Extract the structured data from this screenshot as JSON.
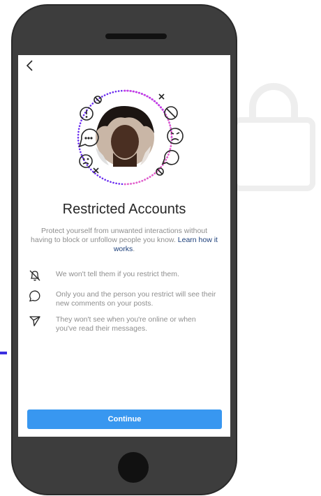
{
  "header": {
    "back_icon": "chevron-left-icon"
  },
  "hero": {
    "icons": [
      "warning-bubble-icon",
      "ellipsis-bubble-icon",
      "sad-face-icon",
      "angry-face-icon",
      "blocked-icon",
      "close-x-icon",
      "empty-bubble-icon"
    ],
    "ring_colors": [
      "#7b2cf5",
      "#c93cf0",
      "#f36fc0"
    ]
  },
  "content": {
    "title": "Restricted Accounts",
    "subtitle": "Protect yourself from unwanted interactions without having to block or unfollow people you know.",
    "learn_link": "Learn how it works",
    "period": "."
  },
  "features": [
    {
      "icon": "bell-off-icon",
      "text": "We won't tell them if you restrict them."
    },
    {
      "icon": "comment-bubble-icon",
      "text": "Only you and the person you restrict will see their new comments on your posts."
    },
    {
      "icon": "paper-plane-icon",
      "text": "They won't see when you're online or when you've read their messages."
    }
  ],
  "actions": {
    "continue_label": "Continue"
  },
  "colors": {
    "accent": "#3897f0",
    "link": "#1c3f7a",
    "text_muted": "#8e8e8e",
    "text_dark": "#262626"
  }
}
